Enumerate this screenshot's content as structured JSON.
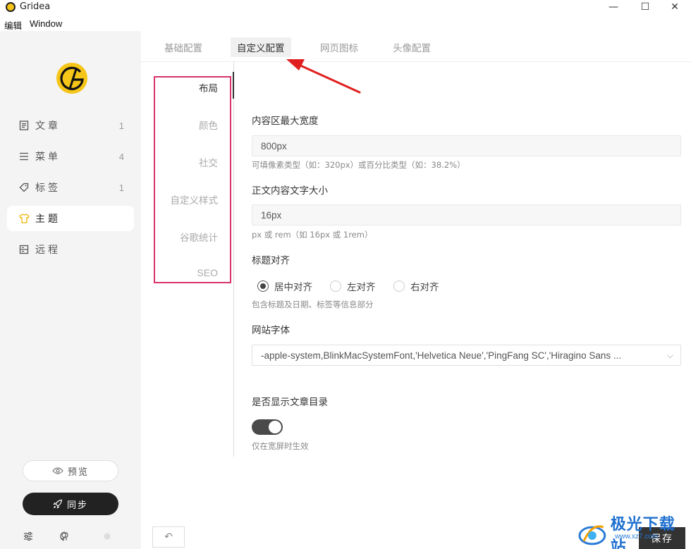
{
  "window": {
    "title": "Gridea",
    "controls": {
      "minimize": "—",
      "maximize": "☐",
      "close": "✕"
    }
  },
  "menu": {
    "edit": "编辑",
    "window": "Window"
  },
  "sidebar": {
    "items": [
      {
        "label": "文章",
        "count": "1",
        "icon": "document-icon"
      },
      {
        "label": "菜单",
        "count": "4",
        "icon": "menu-icon"
      },
      {
        "label": "标签",
        "count": "1",
        "icon": "tag-icon"
      },
      {
        "label": "主题",
        "count": "",
        "icon": "shirt-icon",
        "active": true
      },
      {
        "label": "远程",
        "count": "",
        "icon": "server-icon"
      }
    ],
    "preview_label": "预览",
    "sync_label": "同步"
  },
  "tabs": [
    {
      "label": "基础配置"
    },
    {
      "label": "自定义配置",
      "active": true
    },
    {
      "label": "网页图标"
    },
    {
      "label": "头像配置"
    }
  ],
  "subnav": [
    {
      "label": "布局",
      "active": true
    },
    {
      "label": "颜色"
    },
    {
      "label": "社交"
    },
    {
      "label": "自定义样式"
    },
    {
      "label": "谷歌统计"
    },
    {
      "label": "SEO"
    }
  ],
  "form": {
    "max_width": {
      "label": "内容区最大宽度",
      "value": "800px",
      "hint": "可填像素类型（如：320px）或百分比类型（如：38.2%）"
    },
    "font_size": {
      "label": "正文内容文字大小",
      "value": "16px",
      "hint": "px 或 rem（如 16px 或 1rem）"
    },
    "title_align": {
      "label": "标题对齐",
      "options": [
        "居中对齐",
        "左对齐",
        "右对齐"
      ],
      "selected": "居中对齐",
      "hint": "包含标题及日期、标签等信息部分"
    },
    "site_font": {
      "label": "网站字体",
      "value": "-apple-system,BlinkMacSystemFont,'Helvetica Neue','PingFang SC','Hiragino Sans ..."
    },
    "show_toc": {
      "label": "是否显示文章目录",
      "enabled": true,
      "hint": "仅在宽屏时生效"
    }
  },
  "footer": {
    "undo_label": "↶",
    "save_label": "保存"
  },
  "watermark": {
    "text": "极光下载站",
    "sub": "www.xz7.com"
  },
  "colors": {
    "highlight": "#d6336c",
    "arrow": "#e02020",
    "accent": "#f5c518"
  }
}
